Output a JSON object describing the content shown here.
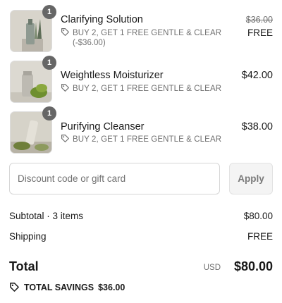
{
  "items": [
    {
      "name": "Clarifying Solution",
      "quantity": "1",
      "discount_label": "BUY 2, GET 1 FREE GENTLE & CLEAR",
      "discount_amount": "(-$36.00)",
      "original_price": "$36.00",
      "price": "FREE",
      "image": "clarifying-solution-product-photo"
    },
    {
      "name": "Weightless Moisturizer",
      "quantity": "1",
      "discount_label": "BUY 2, GET 1 FREE GENTLE & CLEAR",
      "price": "$42.00",
      "image": "weightless-moisturizer-product-photo"
    },
    {
      "name": "Purifying Cleanser",
      "quantity": "1",
      "discount_label": "BUY 2, GET 1 FREE GENTLE & CLEAR",
      "price": "$38.00",
      "image": "purifying-cleanser-product-photo"
    }
  ],
  "discount_field": {
    "placeholder": "Discount code or gift card",
    "value": ""
  },
  "apply_button": "Apply",
  "summary": {
    "subtotal_label": "Subtotal · 3 items",
    "subtotal_value": "$80.00",
    "shipping_label": "Shipping",
    "shipping_value": "FREE",
    "total_label": "Total",
    "currency": "USD",
    "total_value": "$80.00",
    "savings_label": "TOTAL SAVINGS",
    "savings_value": "$36.00"
  },
  "icons": {
    "discount_tag": "tag-icon",
    "savings_tag": "tag-icon"
  },
  "colors": {
    "text_primary": "#1a1a1a",
    "text_secondary": "#707070",
    "badge_bg": "#666666",
    "thumb_bg": "#d9d6cf",
    "button_bg": "#f4f4f4"
  }
}
